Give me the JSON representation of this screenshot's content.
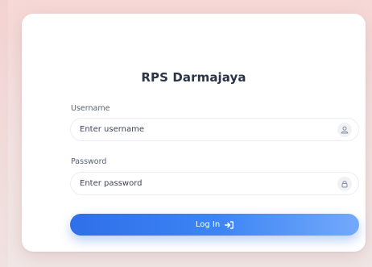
{
  "app": {
    "title": "RPS Darmajaya"
  },
  "form": {
    "username": {
      "label": "Username",
      "placeholder": "Enter username",
      "value": "",
      "icon": "user-icon"
    },
    "password": {
      "label": "Password",
      "placeholder": "Enter password",
      "value": "",
      "icon": "lock-icon"
    },
    "submit": {
      "label": "Log In",
      "icon": "sign-in-icon"
    }
  },
  "colors": {
    "primary": "#3c84f4",
    "title": "#2c3447",
    "background": "#f6d8d6"
  }
}
